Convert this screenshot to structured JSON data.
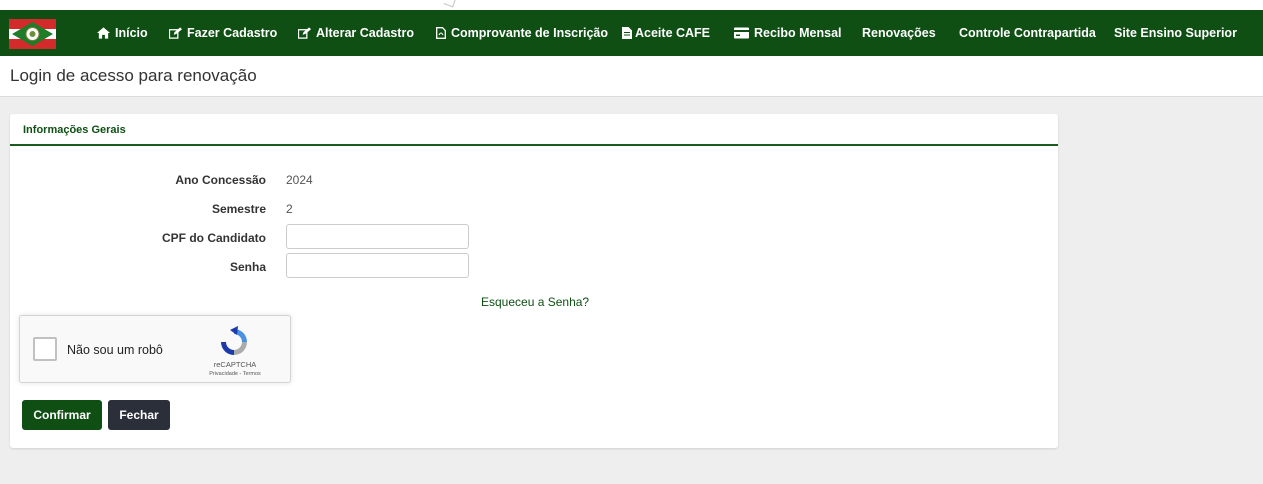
{
  "navbar": {
    "items": [
      {
        "label": "Início",
        "icon": "home-icon"
      },
      {
        "label": "Fazer Cadastro",
        "icon": "edit-icon"
      },
      {
        "label": "Alterar Cadastro",
        "icon": "edit-icon"
      },
      {
        "label": "Comprovante de Inscrição",
        "icon": "pdf-file-icon"
      },
      {
        "label": "Aceite CAFE",
        "icon": "file-icon"
      },
      {
        "label": "Recibo Mensal",
        "icon": "credit-card-icon"
      },
      {
        "label": "Renovações",
        "icon": ""
      },
      {
        "label": "Controle Contrapartida",
        "icon": ""
      },
      {
        "label": "Site Ensino Superior",
        "icon": ""
      }
    ],
    "background": "#0f4f14"
  },
  "page": {
    "title": "Login de acesso para renovação"
  },
  "panel": {
    "heading": "Informações Gerais",
    "fields": {
      "ano_label": "Ano Concessão",
      "ano_value": "2024",
      "semestre_label": "Semestre",
      "semestre_value": "2",
      "cpf_label": "CPF do Candidato",
      "cpf_value": "",
      "senha_label": "Senha",
      "senha_value": ""
    },
    "forgot_link": "Esqueceu a Senha?",
    "captcha": {
      "label": "Não sou um robô",
      "brand": "reCAPTCHA",
      "privacy": "Privacidade",
      "terms": "Termos"
    },
    "buttons": {
      "confirm": "Confirmar",
      "close": "Fechar"
    }
  }
}
